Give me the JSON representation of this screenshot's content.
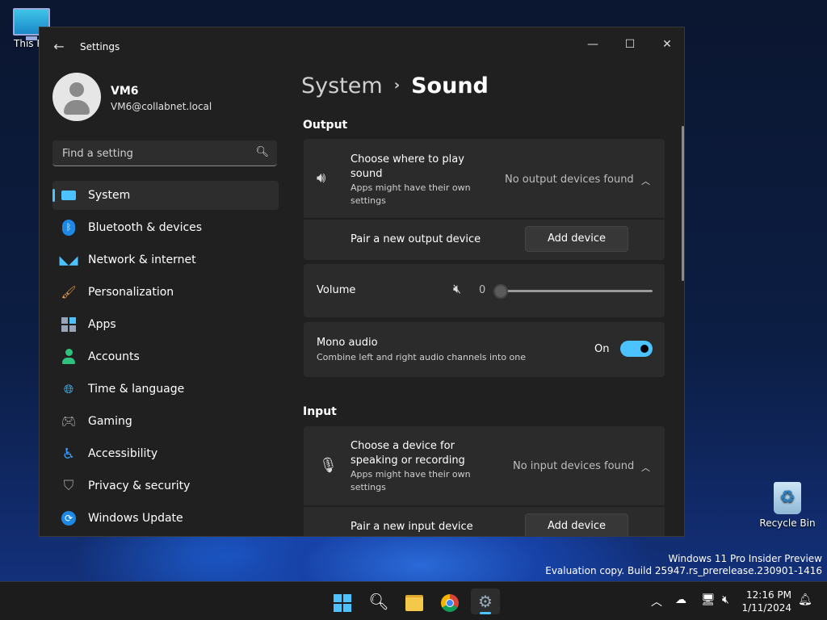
{
  "desktop": {
    "this_pc_label": "This PC",
    "recycle_bin_label": "Recycle Bin",
    "watermark_line1": "Windows 11 Pro Insider Preview",
    "watermark_line2": "Evaluation copy. Build 25947.rs_prerelease.230901-1416"
  },
  "window": {
    "title": "Settings",
    "minimize": "—",
    "maximize": "☐",
    "close": "✕"
  },
  "user": {
    "name": "VM6",
    "email": "VM6@collabnet.local"
  },
  "search": {
    "placeholder": "Find a setting"
  },
  "sidebar": {
    "items": [
      {
        "label": "System",
        "icon": "system-icon",
        "color": "#4cc2ff"
      },
      {
        "label": "Bluetooth & devices",
        "icon": "bluetooth-icon",
        "color": "#1e88e5"
      },
      {
        "label": "Network & internet",
        "icon": "wifi-icon",
        "color": "#4cc2ff"
      },
      {
        "label": "Personalization",
        "icon": "brush-icon",
        "color": "#f0a050"
      },
      {
        "label": "Apps",
        "icon": "apps-icon",
        "color": "#9aa4b8"
      },
      {
        "label": "Accounts",
        "icon": "accounts-icon",
        "color": "#2ec27e"
      },
      {
        "label": "Time & language",
        "icon": "clock-globe-icon",
        "color": "#4cc2ff"
      },
      {
        "label": "Gaming",
        "icon": "gamepad-icon",
        "color": "#b0b0b0"
      },
      {
        "label": "Accessibility",
        "icon": "accessibility-icon",
        "color": "#3aa0ff"
      },
      {
        "label": "Privacy & security",
        "icon": "shield-icon",
        "color": "#9a9a9a"
      },
      {
        "label": "Windows Update",
        "icon": "update-icon",
        "color": "#1e88e5"
      }
    ]
  },
  "breadcrumb": {
    "parent": "System",
    "separator": "›",
    "current": "Sound"
  },
  "output": {
    "heading": "Output",
    "choose_title": "Choose where to play sound",
    "choose_sub": "Apps might have their own settings",
    "choose_value": "No output devices found",
    "pair_label": "Pair a new output device",
    "pair_button": "Add device",
    "volume_label": "Volume",
    "volume_value": "0",
    "mono_title": "Mono audio",
    "mono_sub": "Combine left and right audio channels into one",
    "mono_state": "On"
  },
  "input": {
    "heading": "Input",
    "choose_title": "Choose a device for speaking or recording",
    "choose_sub": "Apps might have their own settings",
    "choose_value": "No input devices found",
    "pair_label": "Pair a new input device",
    "pair_button": "Add device"
  },
  "taskbar": {
    "time": "12:16 PM",
    "date": "1/11/2024"
  }
}
